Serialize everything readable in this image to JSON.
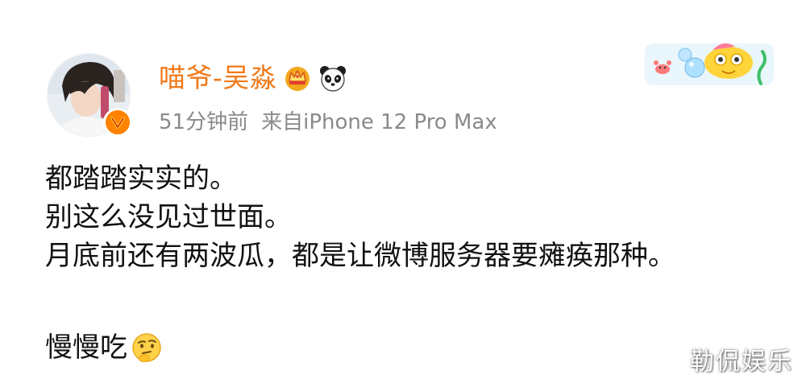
{
  "user": {
    "name": "喵爷-吴淼",
    "avatar_icon": "avatar-photo",
    "verified_icon": "verified-v-icon",
    "badge_icons": [
      "crown-icon",
      "panda-icon"
    ]
  },
  "meta": {
    "time": "51分钟前",
    "source": "来自iPhone 12 Pro Max"
  },
  "post": {
    "lines": [
      "都踏踏实实的。",
      "别这么没见过世面。",
      "月底前还有两波瓜，都是让微博服务器要瘫痪那种。",
      "",
      "慢慢吃"
    ],
    "trailing_emoji": "thinking-emoji-icon"
  },
  "watermark": "勒侃娱乐",
  "colors": {
    "username": "#f07a1b",
    "meta": "#8a8a8a",
    "verified_badge": "#ff8200",
    "text": "#111111"
  }
}
